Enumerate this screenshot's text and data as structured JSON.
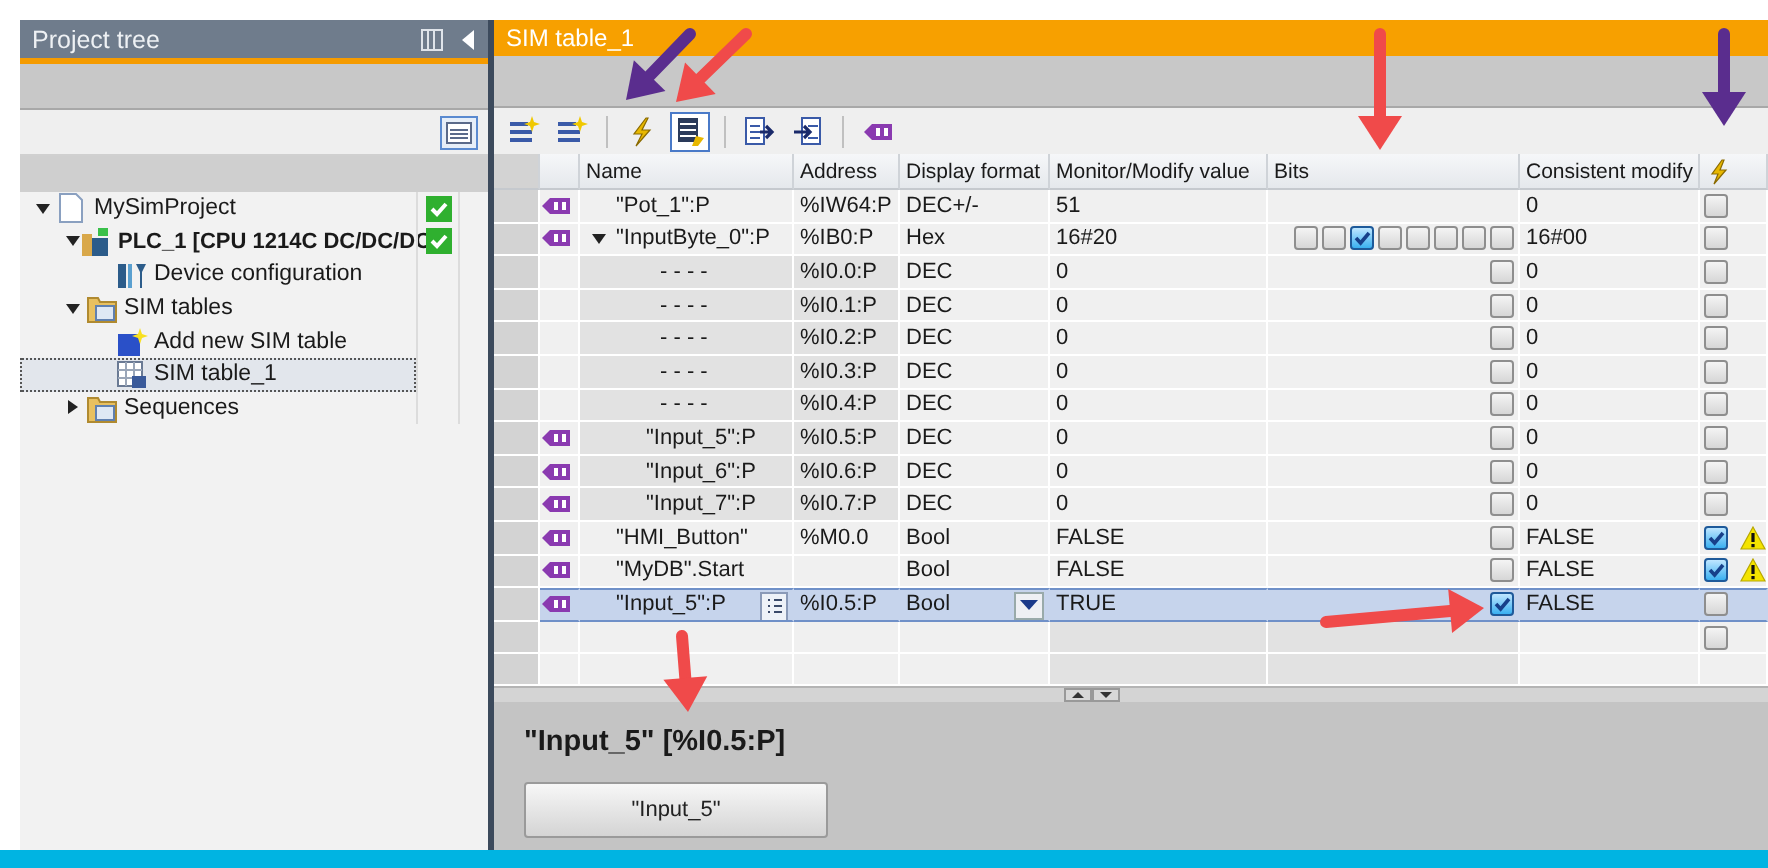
{
  "project_tree": {
    "title": "Project tree",
    "items": [
      {
        "kind": "project",
        "label": "MySimProject",
        "ok": true,
        "selected": false,
        "expanded": true,
        "children": [
          {
            "kind": "plc",
            "label": "PLC_1 [CPU 1214C DC/DC/DC",
            "ok": true,
            "selected": false,
            "expanded": true,
            "children": [
              {
                "kind": "device",
                "label": "Device configuration",
                "ok": false,
                "selected": false
              }
            ]
          },
          {
            "kind": "sim-folder",
            "label": "SIM tables",
            "ok": false,
            "selected": false,
            "expanded": true,
            "children": [
              {
                "kind": "add",
                "label": "Add new SIM table",
                "ok": false,
                "selected": false
              },
              {
                "kind": "table",
                "label": "SIM table_1",
                "ok": false,
                "selected": true
              }
            ]
          },
          {
            "kind": "sequence-folder",
            "label": "Sequences",
            "ok": false,
            "selected": false,
            "expanded": false
          }
        ]
      }
    ]
  },
  "editor": {
    "title": "SIM table_1",
    "toolbar": [
      {
        "kind": "add",
        "selected": false
      },
      {
        "kind": "add",
        "selected": false
      },
      {
        "kind": "lightning",
        "selected": false
      },
      {
        "kind": "modify",
        "selected": true
      },
      {
        "kind": "export",
        "selected": false
      },
      {
        "kind": "import",
        "selected": false
      },
      {
        "kind": "tag",
        "selected": false
      }
    ],
    "columns": [
      "Name",
      "Address",
      "Display format",
      "Monitor/Modify value",
      "Bits",
      "Consistent modify"
    ],
    "rows": [
      {
        "kind": "tag",
        "name": "\"Pot_1\":P",
        "address": "%IW64:P",
        "format": "DEC+/-",
        "value": "51",
        "consistent": "0",
        "modify_now": false,
        "warning": false,
        "selected": false
      },
      {
        "kind": "tag",
        "name": "\"InputByte_0\":P",
        "address": "%IB0:P",
        "format": "Hex",
        "value": "16#20",
        "bits": [
          false,
          false,
          true,
          false,
          false,
          false,
          false,
          false
        ],
        "consistent": "16#00",
        "modify_now": false,
        "warning": false,
        "selected": false,
        "expanded": true,
        "children": [
          {
            "kind": "unnamed",
            "name": "- - - -",
            "address": "%I0.0:P",
            "format": "DEC",
            "value": "0",
            "bit": false,
            "consistent": "0",
            "modify_now": false,
            "warning": false,
            "selected": false
          },
          {
            "kind": "unnamed",
            "name": "- - - -",
            "address": "%I0.1:P",
            "format": "DEC",
            "value": "0",
            "bit": false,
            "consistent": "0",
            "modify_now": false,
            "warning": false,
            "selected": false
          },
          {
            "kind": "unnamed",
            "name": "- - - -",
            "address": "%I0.2:P",
            "format": "DEC",
            "value": "0",
            "bit": false,
            "consistent": "0",
            "modify_now": false,
            "warning": false,
            "selected": false
          },
          {
            "kind": "unnamed",
            "name": "- - - -",
            "address": "%I0.3:P",
            "format": "DEC",
            "value": "0",
            "bit": false,
            "consistent": "0",
            "modify_now": false,
            "warning": false,
            "selected": false
          },
          {
            "kind": "unnamed",
            "name": "- - - -",
            "address": "%I0.4:P",
            "format": "DEC",
            "value": "0",
            "bit": false,
            "consistent": "0",
            "modify_now": false,
            "warning": false,
            "selected": false
          },
          {
            "kind": "tag",
            "name": "\"Input_5\":P",
            "address": "%I0.5:P",
            "format": "DEC",
            "value": "0",
            "bit": false,
            "consistent": "0",
            "modify_now": false,
            "warning": false,
            "selected": false
          },
          {
            "kind": "tag",
            "name": "\"Input_6\":P",
            "address": "%I0.6:P",
            "format": "DEC",
            "value": "0",
            "bit": false,
            "consistent": "0",
            "modify_now": false,
            "warning": false,
            "selected": false
          },
          {
            "kind": "tag",
            "name": "\"Input_7\":P",
            "address": "%I0.7:P",
            "format": "DEC",
            "value": "0",
            "bit": false,
            "consistent": "0",
            "modify_now": false,
            "warning": false,
            "selected": false
          }
        ]
      },
      {
        "kind": "tag",
        "name": "\"HMI_Button\"",
        "address": "%M0.0",
        "format": "Bool",
        "value": "FALSE",
        "bit": false,
        "consistent": "FALSE",
        "modify_now": true,
        "warning": true,
        "selected": false
      },
      {
        "kind": "tag",
        "name": "\"MyDB\".Start",
        "format": "Bool",
        "value": "FALSE",
        "bit": false,
        "consistent": "FALSE",
        "modify_now": true,
        "warning": true,
        "selected": false
      },
      {
        "kind": "tag",
        "name": "\"Input_5\":P",
        "address": "%I0.5:P",
        "format": "Bool",
        "value": "TRUE",
        "bit": true,
        "consistent": "FALSE",
        "modify_now": false,
        "warning": false,
        "selected": true
      },
      {
        "kind": "empty",
        "modify_now": false
      }
    ],
    "detail": {
      "heading": "\"Input_5\" [%I0.5:P]",
      "button": "\"Input_5\""
    }
  }
}
